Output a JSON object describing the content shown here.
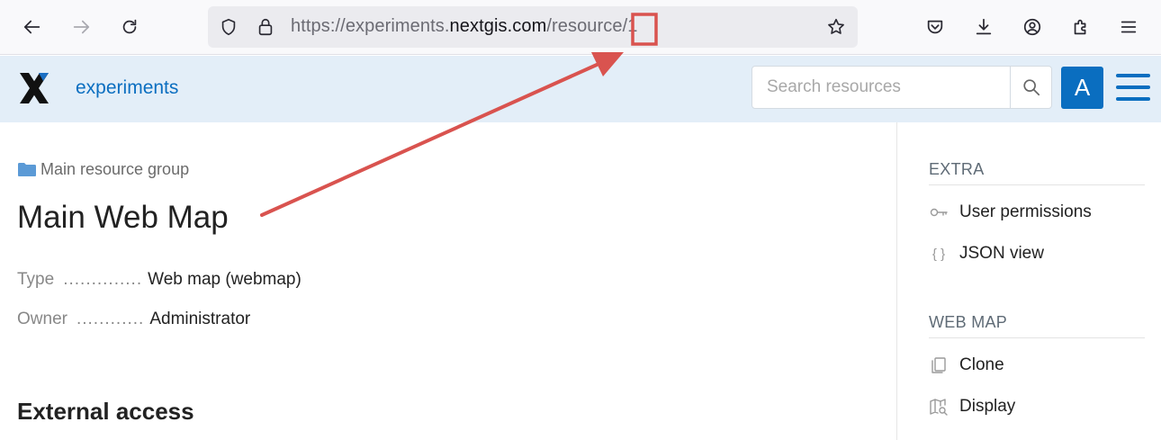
{
  "browser": {
    "url_prefix": "https://experiments.",
    "url_domain": "nextgis.com",
    "url_path": "/resource/1"
  },
  "app": {
    "name": "experiments",
    "search_placeholder": "Search resources",
    "avatar_letter": "A",
    "accent_color": "#0a6ec0"
  },
  "breadcrumb": {
    "label": "Main resource group"
  },
  "page": {
    "title": "Main Web Map",
    "properties": [
      {
        "key": "Type",
        "dots": "..............",
        "value": "Web map (webmap)"
      },
      {
        "key": "Owner",
        "dots": "............",
        "value": "Administrator"
      }
    ],
    "section_title": "External access"
  },
  "sidebar": {
    "sections": [
      {
        "title": "EXTRA",
        "items": [
          {
            "label": "User permissions",
            "icon": "key-icon"
          },
          {
            "label": "JSON view",
            "icon": "braces-icon"
          }
        ]
      },
      {
        "title": "WEB MAP",
        "items": [
          {
            "label": "Clone",
            "icon": "copy-icon"
          },
          {
            "label": "Display",
            "icon": "map-search-icon"
          }
        ]
      }
    ]
  },
  "annotation": {
    "color": "#d9534f"
  }
}
